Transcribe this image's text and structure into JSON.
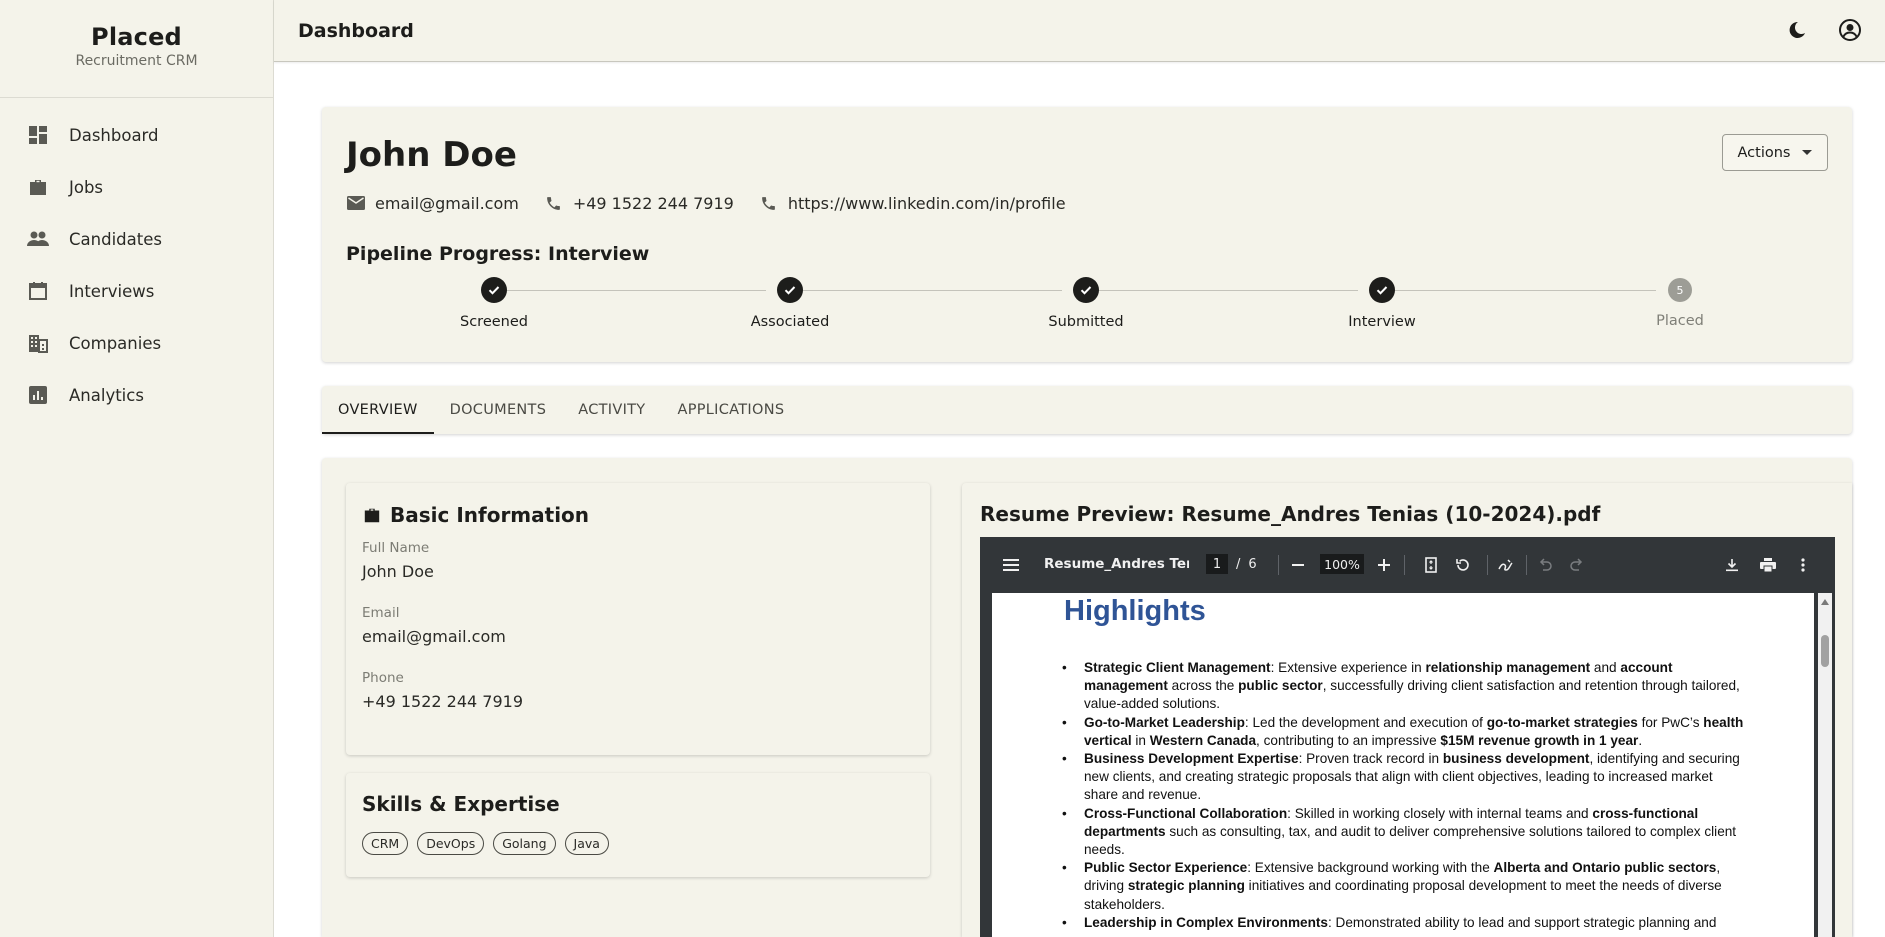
{
  "brand": {
    "name": "Placed",
    "subtitle": "Recruitment CRM"
  },
  "sidebar": {
    "items": [
      {
        "label": "Dashboard",
        "icon": "dashboard-icon"
      },
      {
        "label": "Jobs",
        "icon": "briefcase-icon"
      },
      {
        "label": "Candidates",
        "icon": "people-icon"
      },
      {
        "label": "Interviews",
        "icon": "calendar-icon"
      },
      {
        "label": "Companies",
        "icon": "building-icon"
      },
      {
        "label": "Analytics",
        "icon": "analytics-icon"
      }
    ]
  },
  "topbar": {
    "title": "Dashboard",
    "icons": [
      "dark-mode-icon",
      "account-icon"
    ]
  },
  "candidate": {
    "name": "John Doe",
    "email": "email@gmail.com",
    "phone": "+49 1522 244 7919",
    "linkedin": "https://www.linkedin.com/in/profile",
    "actions_label": "Actions"
  },
  "pipeline": {
    "title": "Pipeline Progress: Interview",
    "steps": [
      {
        "label": "Screened",
        "status": "done"
      },
      {
        "label": "Associated",
        "status": "done"
      },
      {
        "label": "Submitted",
        "status": "done"
      },
      {
        "label": "Interview",
        "status": "done"
      },
      {
        "label": "Placed",
        "status": "pending",
        "number": "5"
      }
    ]
  },
  "tabs": [
    {
      "label": "OVERVIEW",
      "active": true
    },
    {
      "label": "DOCUMENTS",
      "active": false
    },
    {
      "label": "ACTIVITY",
      "active": false
    },
    {
      "label": "APPLICATIONS",
      "active": false
    }
  ],
  "basic_info": {
    "title": "Basic Information",
    "fields": [
      {
        "label": "Full Name",
        "value": "John Doe"
      },
      {
        "label": "Email",
        "value": "email@gmail.com"
      },
      {
        "label": "Phone",
        "value": "+49 1522 244 7919"
      }
    ]
  },
  "skills": {
    "title": "Skills & Expertise",
    "items": [
      "CRM",
      "DevOps",
      "Golang",
      "Java"
    ]
  },
  "resume": {
    "title": "Resume Preview: Resume_Andres Tenias (10-2024).pdf",
    "viewer": {
      "file_name": "Resume_Andres Teni...",
      "page_current": "1",
      "page_separator": "/",
      "page_total": "6",
      "zoom": "100%"
    },
    "doc_heading": "Highlights",
    "doc_items": [
      {
        "title": "Strategic Client Management",
        "text_html": "<b>Strategic Client Management</b>: Extensive experience in <b>relationship management</b> and <b>account management</b> across the <b>public sector</b>, successfully driving client satisfaction and retention through tailored, value-added solutions."
      },
      {
        "title": "Go-to-Market Leadership",
        "text_html": "<b>Go-to-Market Leadership</b>: Led the development and execution of <b>go-to-market strategies</b> for PwC’s <b>health vertical</b> in <b>Western Canada</b>, contributing to an impressive <b>$15M revenue growth in 1 year</b>."
      },
      {
        "title": "Business Development Expertise",
        "text_html": "<b>Business Development Expertise</b>: Proven track record in <b>business development</b>, identifying and securing new clients, and creating strategic proposals that align with client objectives, leading to increased market share and revenue."
      },
      {
        "title": "Cross-Functional Collaboration",
        "text_html": "<b>Cross-Functional Collaboration</b>: Skilled in working closely with internal teams and <b>cross-functional departments</b> such as consulting, tax, and audit to deliver comprehensive solutions tailored to complex client needs."
      },
      {
        "title": "Public Sector Experience",
        "text_html": "<b>Public Sector Experience</b>: Extensive background working with the <b>Alberta and Ontario public sectors</b>, driving <b>strategic planning</b> initiatives and coordinating proposal development to meet the needs of diverse stakeholders."
      },
      {
        "title": "Leadership in Complex Environments",
        "text_html": "<b>Leadership in Complex Environments</b>: Demonstrated ability to lead and support strategic planning and"
      }
    ]
  },
  "colors": {
    "background": "#f4f3ea",
    "accent": "#1d1d1b",
    "pdf_toolbar": "#323639",
    "doc_heading": "#2f5496"
  }
}
